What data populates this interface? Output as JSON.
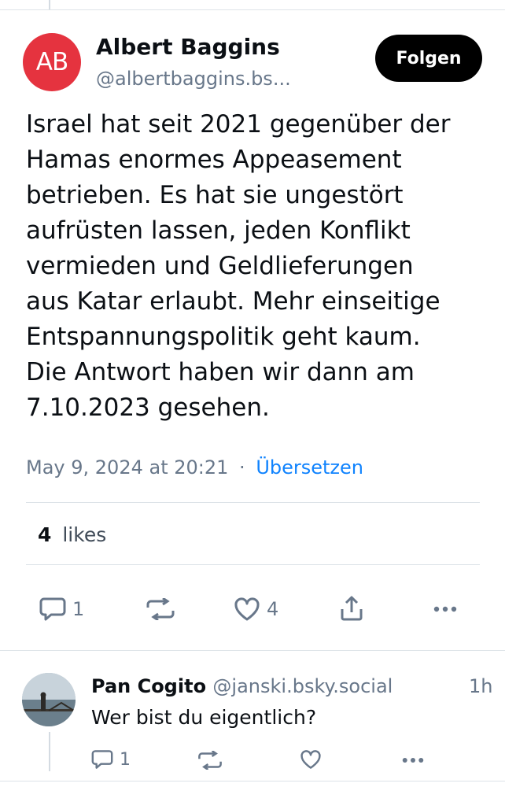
{
  "post": {
    "author": {
      "initials": "AB",
      "name": "Albert Baggins",
      "handle": "@albertbaggins.bs...",
      "avatar_color": "#e5333f"
    },
    "follow_label": "Folgen",
    "text": "Israel hat seit 2021 gegenüber der\nHamas enormes Appeasement\nbetrieben. Es hat sie ungestört\naufrüsten lassen, jeden Konflikt\nvermieden und Geldlieferungen\naus Katar erlaubt. Mehr einseitige\nEntspannungspolitik geht kaum.\nDie Antwort haben wir dann am\n7.10.2023 gesehen.",
    "timestamp": "May 9, 2024 at 20:21",
    "separator": "·",
    "translate_label": "Übersetzen",
    "likes_count": "4",
    "likes_label": "likes",
    "actions": {
      "reply_count": "1",
      "repost_count": "",
      "like_count": "4"
    }
  },
  "reply": {
    "name": "Pan Cogito",
    "handle": "@janski.bsky.social",
    "time": "1h",
    "text": "Wer bist du eigentlich?",
    "actions": {
      "reply_count": "1"
    }
  },
  "icons": {
    "reply": "speech-bubble-icon",
    "repost": "repost-icon",
    "like": "heart-icon",
    "share": "share-icon",
    "more": "more-dots-icon"
  },
  "colors": {
    "accent_link": "#1083fe",
    "muted_text": "#68778a",
    "follow_button_bg": "#000000"
  }
}
